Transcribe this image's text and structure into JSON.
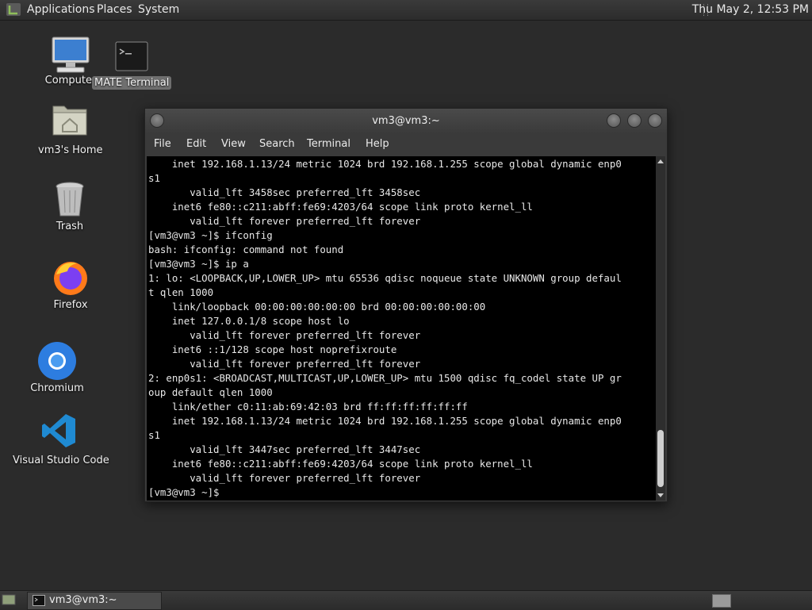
{
  "top_panel": {
    "menus": [
      "Applications",
      "Places",
      "System"
    ],
    "clock": "Thu May  2, 12:53 PM"
  },
  "desktop_icons": [
    {
      "label": "Computer",
      "icon": "computer-icon"
    },
    {
      "label": "MATE Terminal",
      "icon": "terminal-icon"
    },
    {
      "label": "vm3's Home",
      "icon": "home-folder-icon"
    },
    {
      "label": "Trash",
      "icon": "trash-icon"
    },
    {
      "label": "Firefox",
      "icon": "firefox-icon"
    },
    {
      "label": "Chromium",
      "icon": "chromium-icon"
    },
    {
      "label": "Visual Studio Code",
      "icon": "vscode-icon"
    }
  ],
  "terminal": {
    "title": "vm3@vm3:~",
    "menus": [
      "File",
      "Edit",
      "View",
      "Search",
      "Terminal",
      "Help"
    ],
    "lines": [
      "    inet 192.168.1.13/24 metric 1024 brd 192.168.1.255 scope global dynamic enp0",
      "s1",
      "       valid_lft 3458sec preferred_lft 3458sec",
      "    inet6 fe80::c211:abff:fe69:4203/64 scope link proto kernel_ll",
      "       valid_lft forever preferred_lft forever",
      "[vm3@vm3 ~]$ ifconfig",
      "bash: ifconfig: command not found",
      "[vm3@vm3 ~]$ ip a",
      "1: lo: <LOOPBACK,UP,LOWER_UP> mtu 65536 qdisc noqueue state UNKNOWN group defaul",
      "t qlen 1000",
      "    link/loopback 00:00:00:00:00:00 brd 00:00:00:00:00:00",
      "    inet 127.0.0.1/8 scope host lo",
      "       valid_lft forever preferred_lft forever",
      "    inet6 ::1/128 scope host noprefixroute",
      "       valid_lft forever preferred_lft forever",
      "2: enp0s1: <BROADCAST,MULTICAST,UP,LOWER_UP> mtu 1500 qdisc fq_codel state UP gr",
      "oup default qlen 1000",
      "    link/ether c0:11:ab:69:42:03 brd ff:ff:ff:ff:ff:ff",
      "    inet 192.168.1.13/24 metric 1024 brd 192.168.1.255 scope global dynamic enp0",
      "s1",
      "       valid_lft 3447sec preferred_lft 3447sec",
      "    inet6 fe80::c211:abff:fe69:4203/64 scope link proto kernel_ll",
      "       valid_lft forever preferred_lft forever",
      "[vm3@vm3 ~]$ "
    ]
  },
  "taskbar": {
    "window_item": "vm3@vm3:~"
  },
  "colors": {
    "desktop": "#2b2b2b",
    "panel": "#333333",
    "terminal_bg": "#000000",
    "terminal_fg": "#e8e8e8"
  }
}
